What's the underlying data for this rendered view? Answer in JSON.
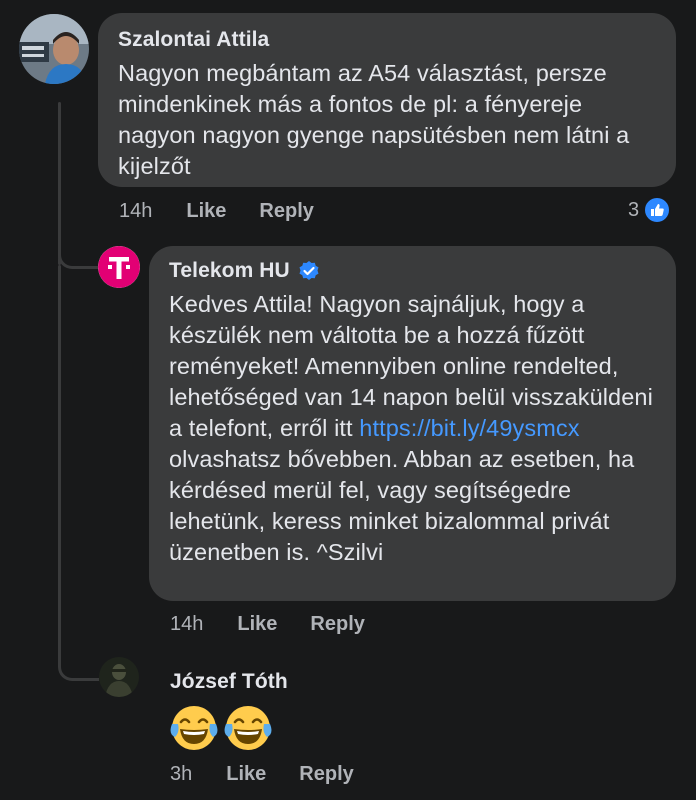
{
  "comments": [
    {
      "author": "Szalontai Attila",
      "text": "Nagyon megbántam az A54 választást, persze mindenkinek más a fontos de pl: a fényereje nagyon nagyon gyenge napsütésben nem látni a kijelzőt",
      "time": "14h",
      "like_label": "Like",
      "reply_label": "Reply",
      "reaction_count": "3"
    },
    {
      "author": "Telekom HU",
      "verified": true,
      "text_before_link": "Kedves Attila! Nagyon sajnáljuk, hogy a készülék nem váltotta be a hozzá fűzött reményeket! Amennyiben online rendelted, lehetőséged van 14 napon belül visszaküldeni a telefont, erről itt ",
      "link": "https://bit.ly/49ysmcx",
      "text_after_link": " olvashatsz bővebben. Abban az esetben, ha kérdésed merül fel, vagy segítségedre lehetünk, keress minket bizalommal privát üzenetben is. ^Szilvi",
      "time": "14h",
      "like_label": "Like",
      "reply_label": "Reply"
    },
    {
      "author": "József Tóth",
      "emoji": "😂😂",
      "time": "3h",
      "like_label": "Like",
      "reply_label": "Reply"
    }
  ],
  "icons": {
    "telekom_logo": "T",
    "brand_color": "#e20074",
    "like_color": "#2d88ff",
    "verified_color": "#2d88ff"
  }
}
